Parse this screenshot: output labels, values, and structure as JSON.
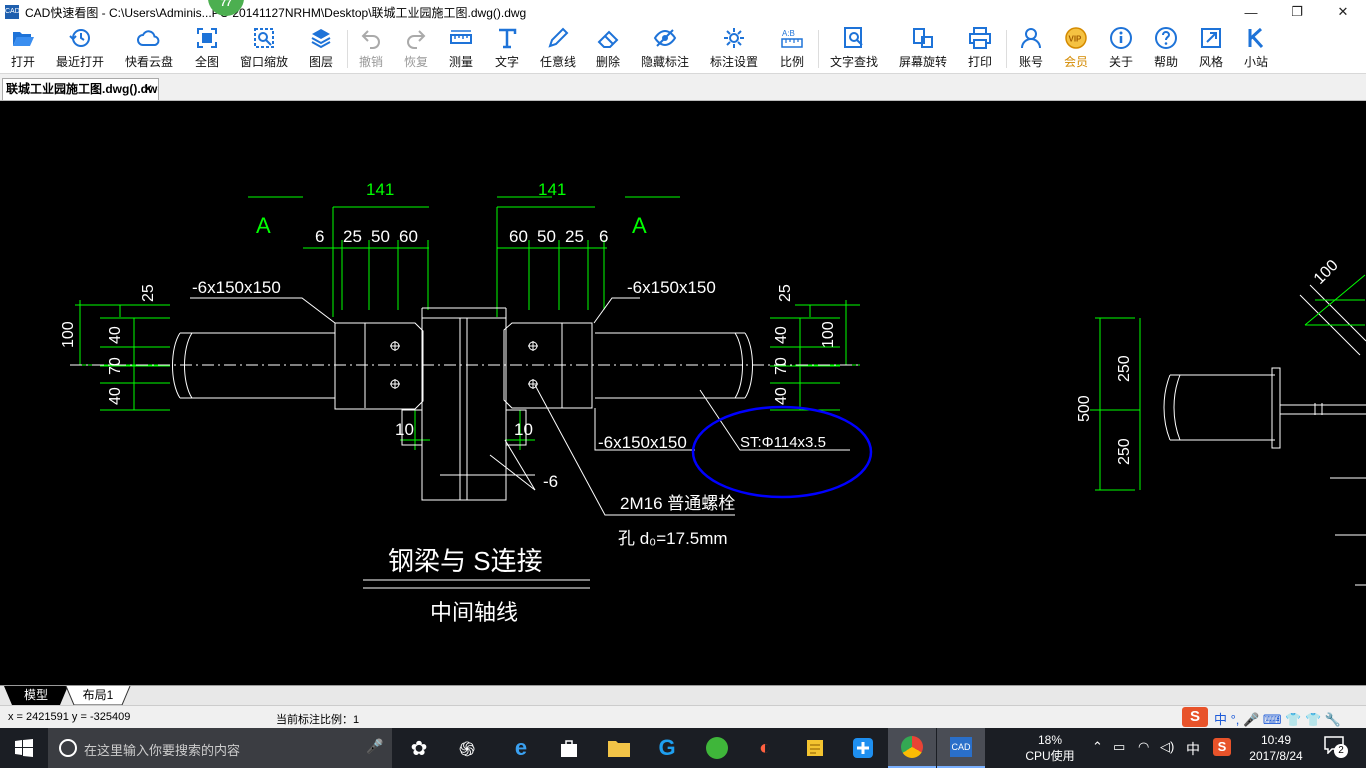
{
  "window": {
    "icon_label": "CAD",
    "title": "CAD快速看图 - C:\\Users\\Adminis...PC-20141127NRHM\\Desktop\\联城工业园施工图.dwg().dwg",
    "badge": "77",
    "minimize": "—",
    "maximize": "❐",
    "close": "✕"
  },
  "toolbar": {
    "open": "打开",
    "recent": "最近打开",
    "cloud": "快看云盘",
    "fit_all": "全图",
    "window_zoom": "窗口缩放",
    "layers": "图层",
    "undo": "撤销",
    "redo": "恢复",
    "measure": "测量",
    "text": "文字",
    "freeline": "任意线",
    "delete": "删除",
    "hide_marks": "隐藏标注",
    "mark_settings": "标注设置",
    "scale": "比例",
    "find_text": "文字查找",
    "rotate_screen": "屏幕旋转",
    "print": "打印",
    "account": "账号",
    "vip": "会员",
    "about": "关于",
    "help": "帮助",
    "style": "风格",
    "station": "小站",
    "scale_icon_text": "A:B"
  },
  "document_tab": {
    "label": "联城工业园施工图.dwg().dwg",
    "close": "✕"
  },
  "drawing": {
    "dim_141_left": "141",
    "dim_141_right": "141",
    "section_a_left": "A",
    "section_a_right": "A",
    "dims_left": [
      "6",
      "25",
      "50",
      "60"
    ],
    "dims_right": [
      "60",
      "50",
      "25",
      "6"
    ],
    "plate_left": "-6x150x150",
    "plate_right": "-6x150x150",
    "plate_bottom": "-6x150x150",
    "dim_25_left": "25",
    "dim_25_right": "25",
    "dim_100_left": "100",
    "dim_100_right": "100",
    "dim_40_left_top": "40",
    "dim_70_left": "70",
    "dim_40_left_bottom": "40",
    "dim_40_right_top": "40",
    "dim_70_right": "70",
    "dim_40_right_bottom": "40",
    "dim_10_left": "10",
    "dim_10_right": "10",
    "dim_minus6": "-6",
    "pipe_spec": "ST:Φ114x3.5",
    "bolt_spec": "2M16  普通螺栓",
    "hole_spec": "孔 d₀=17.5mm",
    "caption_title": "钢梁与  S连接",
    "caption_sub": "中间轴线",
    "dim_500": "500",
    "dim_250_top": "250",
    "dim_250_bottom": "250",
    "dim_100_far": "100"
  },
  "layout_tabs": {
    "model": "模型",
    "layout1": "布局1"
  },
  "status": {
    "coords": "x = 2421591  y = -325409",
    "scale_label": "当前标注比例：1",
    "ime": "中 °, 🎤 ⌨ 👕 👕 🔧"
  },
  "taskbar": {
    "search_placeholder": "在这里输入你要搜索的内容",
    "cpu_percent": "18%",
    "cpu_label": "CPU使用",
    "ime_lang": "中",
    "time": "10:49",
    "date": "2017/8/24",
    "notifications": "2"
  },
  "colors": {
    "dim_green": "#00ff00",
    "line_white": "#ffffff",
    "highlight_blue": "#0000ff"
  }
}
